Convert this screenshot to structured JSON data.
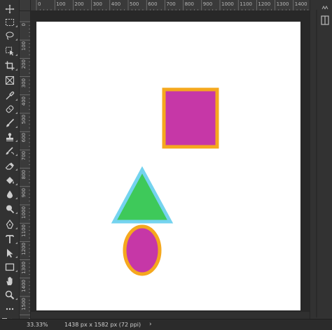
{
  "tools": [
    {
      "name": "move-tool",
      "icon": "move-icon"
    },
    {
      "name": "marquee-tool",
      "icon": "rectangular-marquee-icon"
    },
    {
      "name": "lasso-tool",
      "icon": "lasso-icon"
    },
    {
      "name": "object-selection-tool",
      "icon": "object-selection-icon"
    },
    {
      "name": "crop-tool",
      "icon": "crop-icon"
    },
    {
      "name": "frame-tool",
      "icon": "frame-icon"
    },
    {
      "name": "eyedropper-tool",
      "icon": "eyedropper-icon"
    },
    {
      "name": "healing-brush-tool",
      "icon": "healing-brush-icon"
    },
    {
      "name": "brush-tool",
      "icon": "brush-icon"
    },
    {
      "name": "clone-stamp-tool",
      "icon": "clone-stamp-icon"
    },
    {
      "name": "history-brush-tool",
      "icon": "history-brush-icon"
    },
    {
      "name": "eraser-tool",
      "icon": "eraser-icon"
    },
    {
      "name": "paint-bucket-tool",
      "icon": "paint-bucket-icon"
    },
    {
      "name": "blur-tool",
      "icon": "blur-icon"
    },
    {
      "name": "dodge-tool",
      "icon": "dodge-icon"
    },
    {
      "name": "pen-tool",
      "icon": "pen-icon"
    },
    {
      "name": "type-tool",
      "icon": "type-icon"
    },
    {
      "name": "path-selection-tool",
      "icon": "path-selection-icon"
    },
    {
      "name": "rectangle-tool",
      "icon": "rectangle-icon"
    },
    {
      "name": "hand-tool",
      "icon": "hand-icon"
    },
    {
      "name": "zoom-tool",
      "icon": "zoom-icon"
    },
    {
      "name": "more-tools",
      "icon": "more-icon"
    }
  ],
  "ruler": {
    "h_labels": [
      "0",
      "100",
      "200",
      "300",
      "400",
      "500",
      "600",
      "700",
      "800",
      "900",
      "1000",
      "1100",
      "1200",
      "1300",
      "1400",
      "1500"
    ],
    "v_labels": [
      "0",
      "100",
      "200",
      "300",
      "400",
      "500",
      "600",
      "700",
      "800",
      "900",
      "1000",
      "1100",
      "1200",
      "1300",
      "1400",
      "1500"
    ]
  },
  "shapes": {
    "square": {
      "fill": "#c637a7",
      "stroke": "#f5a81e"
    },
    "triangle": {
      "fill": "#3ec95a",
      "stroke": "#74d3ef"
    },
    "ellipse": {
      "fill": "#c637a7",
      "stroke": "#f5a81e"
    }
  },
  "colors": {
    "canvas": "#ffffff",
    "pasteboard": "#282828",
    "ui_dark": "#323232"
  },
  "status": {
    "zoom": "33.33%",
    "document_size": "1438 px x 1582 px (72 ppi)",
    "arrow": "›"
  },
  "dock": {
    "icons": [
      "collapse-icon",
      "panel-icon"
    ]
  }
}
